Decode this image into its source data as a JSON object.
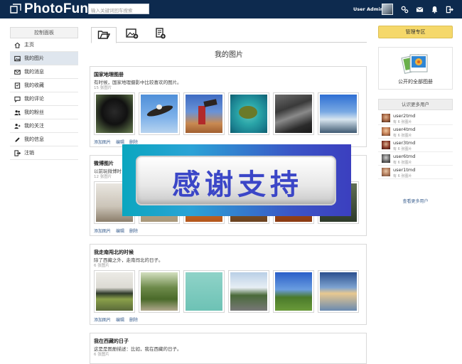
{
  "header": {
    "logo_text": "PhotoFun",
    "search_placeholder": "输入关键词回车搜索",
    "user_name": "User Admin"
  },
  "sidebar": {
    "title": "控制面板",
    "items": [
      {
        "label": "主页",
        "icon": "home-icon"
      },
      {
        "label": "我的图片",
        "icon": "image-icon",
        "active": true
      },
      {
        "label": "我的消息",
        "icon": "envelope-icon"
      },
      {
        "label": "我的收藏",
        "icon": "bookmark-icon"
      },
      {
        "label": "我的评论",
        "icon": "comment-icon"
      },
      {
        "label": "我的粉丝",
        "icon": "users-icon"
      },
      {
        "label": "我的关注",
        "icon": "user-follow-icon"
      },
      {
        "label": "我的信息",
        "icon": "pencil-icon"
      },
      {
        "label": "注销",
        "icon": "logout-icon"
      }
    ]
  },
  "tabs": [
    {
      "icon": "folder-open-icon"
    },
    {
      "icon": "add-image-icon"
    },
    {
      "icon": "add-document-icon"
    }
  ],
  "main": {
    "page_title": "我的图片",
    "albums": [
      {
        "name": "国家地理图册",
        "desc": "有时候，国家地理摄影中比较喜欢的图片。",
        "count": "15 张图片",
        "actions": {
          "add": "添加图片",
          "edit": "编辑",
          "delete": "删除"
        }
      },
      {
        "name": "微博图片",
        "desc": "以前玩微博时",
        "count": "12 张图片",
        "actions": {
          "add": "添加图片",
          "edit": "编辑",
          "delete": "删除"
        }
      },
      {
        "name": "我走南闯北的时候",
        "desc": "除了西藏之外，走南闯北的日子。",
        "count": "6 张图片",
        "actions": {
          "add": "添加图片",
          "edit": "编辑",
          "delete": "删除"
        }
      },
      {
        "name": "我在西藏的日子",
        "desc": "这是是图册描述：比如，我在西藏的日子。",
        "count": "6 张图片"
      }
    ]
  },
  "right": {
    "admin_button": "管理专区",
    "public_albums": "公开的全部图册",
    "know_title": "认识更多用户",
    "users": [
      {
        "name": "user2tmd",
        "count": "有 6 张图片"
      },
      {
        "name": "user4tmd",
        "count": "有 6 张图片"
      },
      {
        "name": "user3tmd",
        "count": "有 6 张图片"
      },
      {
        "name": "user6tmd",
        "count": "有 6 张图片"
      },
      {
        "name": "user1tmd",
        "count": "有 6 张图片"
      }
    ],
    "more_users": "查看更多用户"
  },
  "banner": {
    "text": "感谢支持"
  },
  "colors": {
    "topbar": "#0d2a4e",
    "accent_link": "#3a5f8f",
    "admin_button": "#f5d86a"
  }
}
